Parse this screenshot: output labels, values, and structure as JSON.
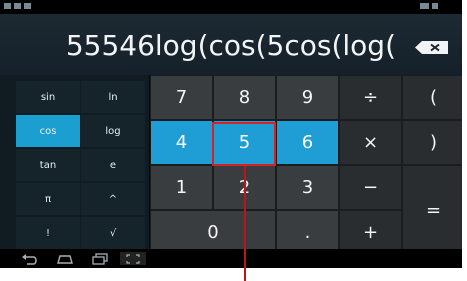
{
  "display": {
    "expression": "55546log(cos(5cos(log("
  },
  "advanced_keys": [
    {
      "name": "sin-button",
      "label": "sin"
    },
    {
      "name": "ln-button",
      "label": "ln"
    },
    {
      "name": "cos-button",
      "label": "cos",
      "active": true
    },
    {
      "name": "log-button",
      "label": "log"
    },
    {
      "name": "tan-button",
      "label": "tan"
    },
    {
      "name": "e-button",
      "label": "e"
    },
    {
      "name": "pi-button",
      "label": "π"
    },
    {
      "name": "power-button",
      "label": "^"
    },
    {
      "name": "factorial-button",
      "label": "!"
    },
    {
      "name": "sqrt-button",
      "label": "√"
    }
  ],
  "keys": [
    {
      "name": "key-7",
      "label": "7"
    },
    {
      "name": "key-8",
      "label": "8"
    },
    {
      "name": "key-9",
      "label": "9"
    },
    {
      "name": "divide-button",
      "label": "÷"
    },
    {
      "name": "open-paren-button",
      "label": "("
    },
    {
      "name": "key-4",
      "label": "4"
    },
    {
      "name": "key-5",
      "label": "5"
    },
    {
      "name": "key-6",
      "label": "6"
    },
    {
      "name": "multiply-button",
      "label": "×"
    },
    {
      "name": "close-paren-button",
      "label": ")"
    },
    {
      "name": "key-1",
      "label": "1"
    },
    {
      "name": "key-2",
      "label": "2"
    },
    {
      "name": "key-3",
      "label": "3"
    },
    {
      "name": "minus-button",
      "label": "−"
    },
    {
      "name": "equals-button",
      "label": "="
    },
    {
      "name": "key-0",
      "label": "0"
    },
    {
      "name": "decimal-button",
      "label": "."
    },
    {
      "name": "plus-button",
      "label": "+"
    }
  ],
  "colors": {
    "accent": "#1e9ed4",
    "annotation": "#d2232a"
  }
}
